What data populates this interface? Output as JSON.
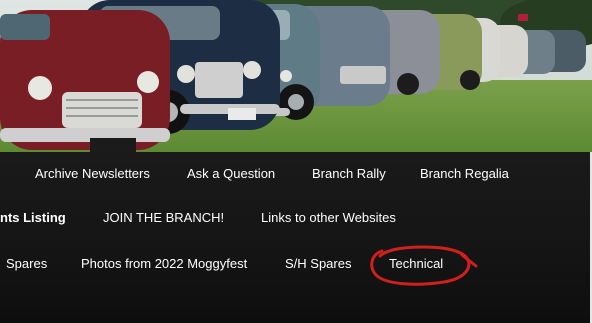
{
  "hero": {
    "image_icon": "classic-cars-photo"
  },
  "nav": {
    "row1": [
      {
        "label": "Archive Newsletters"
      },
      {
        "label": "Ask a Question"
      },
      {
        "label": "Branch Rally"
      },
      {
        "label": "Branch Regalia"
      }
    ],
    "row2": [
      {
        "label": "nts Listing"
      },
      {
        "label": "JOIN THE BRANCH!"
      },
      {
        "label": "Links to other Websites"
      }
    ],
    "row3": [
      {
        "label": "Spares"
      },
      {
        "label": "Photos from 2022 Moggyfest"
      },
      {
        "label": "S/H Spares"
      },
      {
        "label": "Technical"
      }
    ]
  },
  "annotation": {
    "icon": "red-circle-annotation",
    "color": "#d0201c"
  }
}
